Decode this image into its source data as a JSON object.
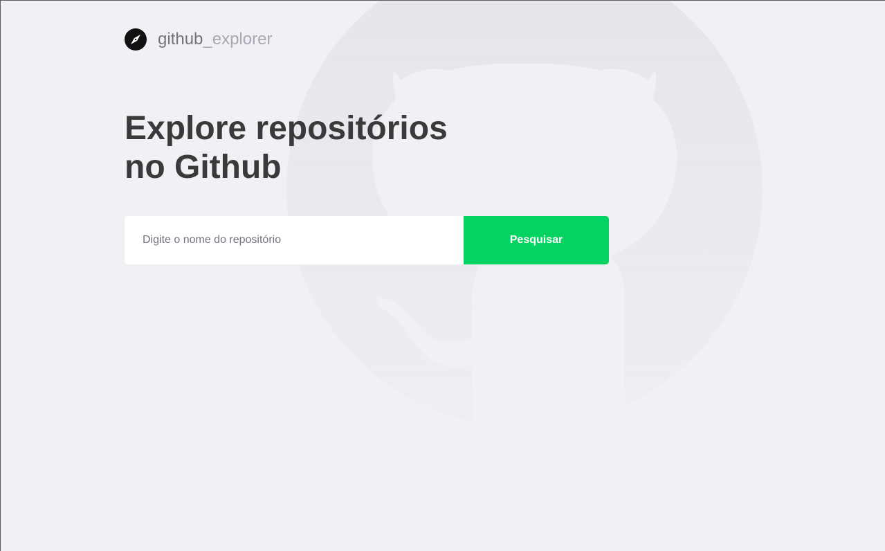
{
  "brand": {
    "name_prefix": "github",
    "name_suffix": "_explorer",
    "icon": "compass-icon"
  },
  "hero": {
    "title_line1": "Explore repositórios",
    "title_line2": "no Github"
  },
  "search": {
    "placeholder": "Digite o nome do repositório",
    "value": "",
    "button_label": "Pesquisar"
  },
  "background": {
    "icon": "github-octocat-icon"
  },
  "colors": {
    "page_background": "#f0f0f5",
    "title": "#3a3a3a",
    "brand_text": "#a8a8b3",
    "button": "#04d361",
    "button_text": "#ffffff",
    "input_background": "#ffffff",
    "placeholder": "#737380"
  }
}
